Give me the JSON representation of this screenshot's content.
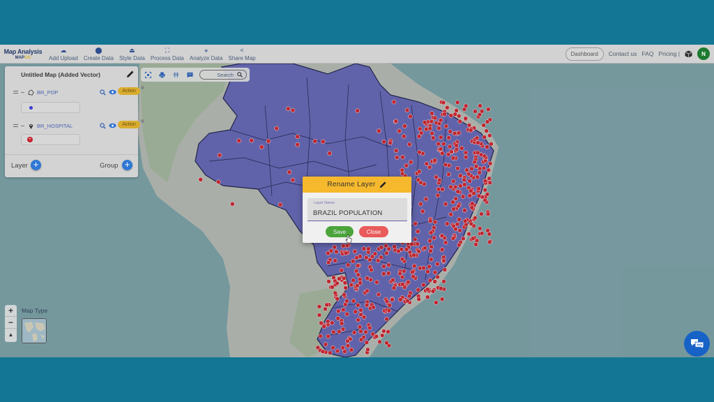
{
  "navbar": {
    "brand_title": "Map Analysis",
    "brand_logo_a": "MAP",
    "brand_logo_b": "OG",
    "items": [
      {
        "label": "Add Upload",
        "icon": "cloud-upload-icon"
      },
      {
        "label": "Create Data",
        "icon": "location-pin-icon"
      },
      {
        "label": "Style Data",
        "icon": "style-icon"
      },
      {
        "label": "Process Data",
        "icon": "process-icon"
      },
      {
        "label": "Analyze Data",
        "icon": "analyze-icon"
      },
      {
        "label": "Share Map",
        "icon": "share-icon"
      }
    ],
    "dashboard_label": "Dashboard",
    "contact_label": "Contact us",
    "faq_label": "FAQ",
    "pricing_label": "Pricing |",
    "avatar_initial": "N"
  },
  "panel": {
    "title": "Untitled Map (Added Vector)",
    "layers": [
      {
        "name": "BR_POP",
        "type": "polygon",
        "action_label": "Action",
        "legend_color": "#3b3bd0"
      },
      {
        "name": "BR_HOSPITAL",
        "type": "point",
        "action_label": "Action",
        "legend_color": "#c71e2f"
      }
    ],
    "add_layer_label": "Layer",
    "add_group_label": "Group"
  },
  "maptools": {
    "search_label": "Search"
  },
  "map": {
    "map_type_label": "Map Type",
    "zoom_in": "+",
    "zoom_out": "−",
    "north": "▲",
    "polygon_fill": "#6767b8",
    "point_color": "#d3222e"
  },
  "modal": {
    "title": "Rename Layer",
    "field_label": "Layer Name",
    "field_value": "BRAZIL POPULATION",
    "save_label": "Save",
    "close_label": "Close"
  }
}
